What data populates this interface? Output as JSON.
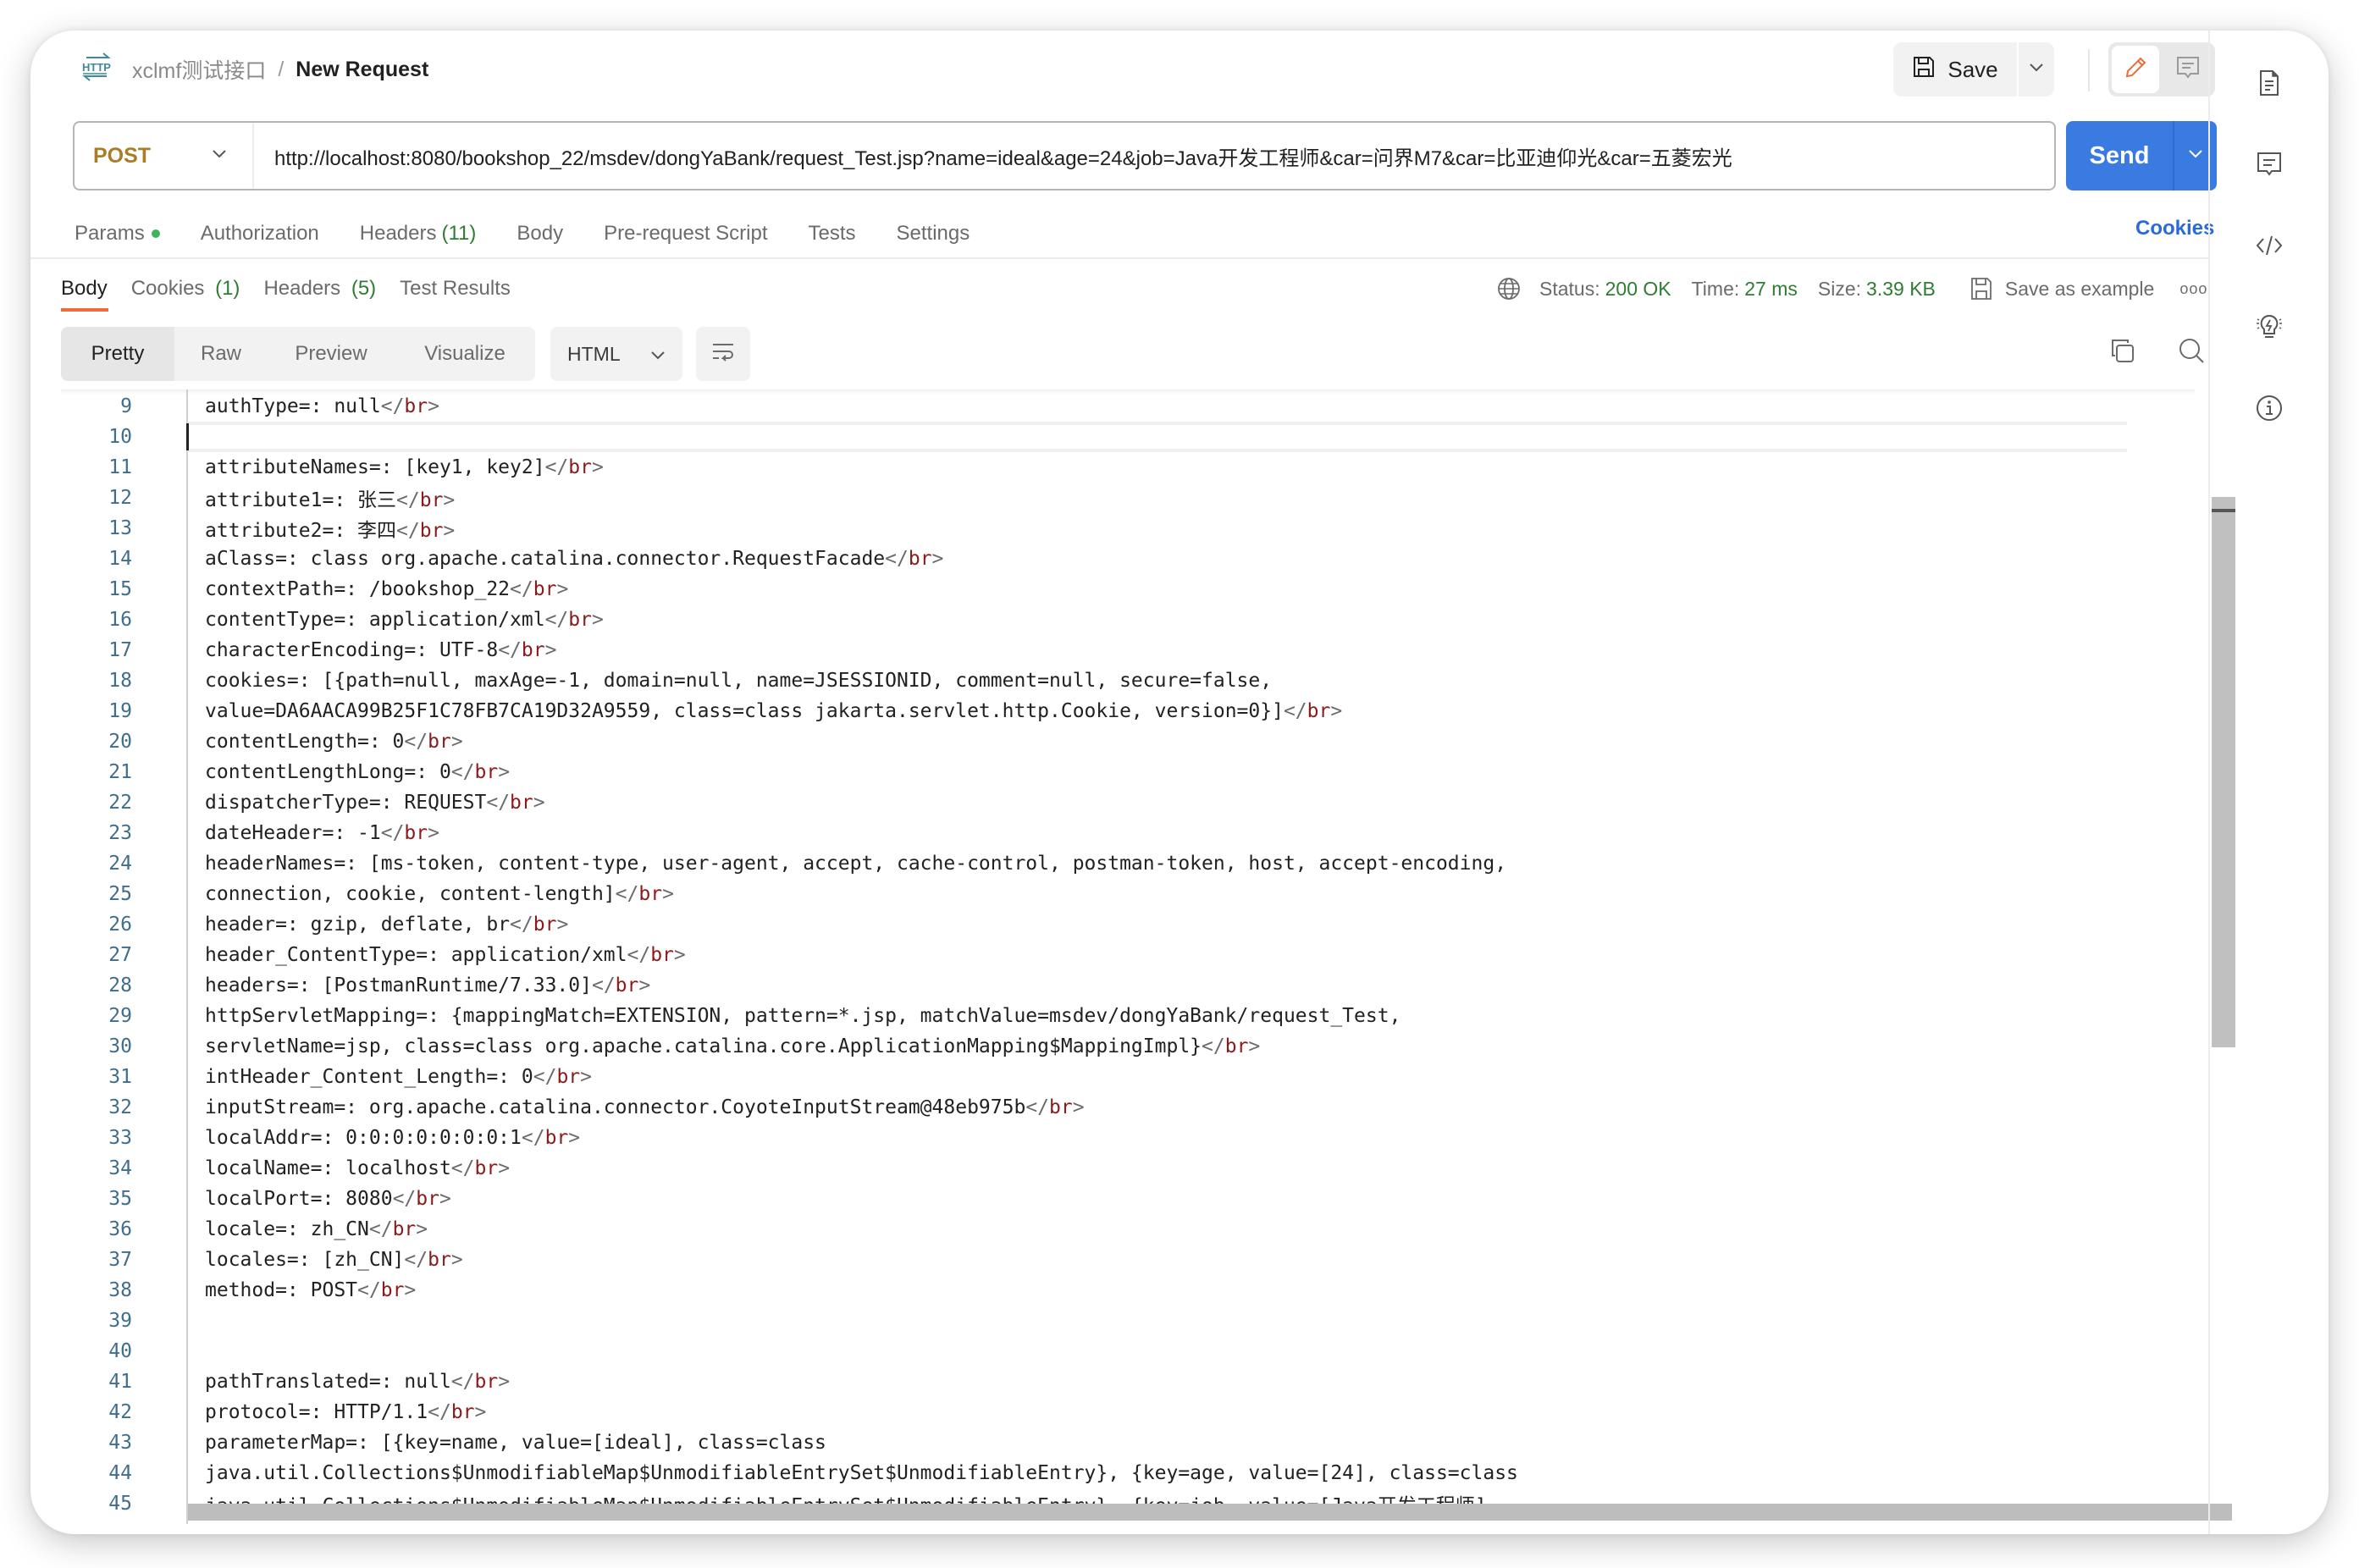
{
  "breadcrumb": {
    "icon": "http-icon",
    "parent": "xclmf测试接口",
    "separator": "/",
    "current": "New Request"
  },
  "toolbar": {
    "save_label": "Save",
    "mode_edit_icon": "pencil-icon",
    "mode_comment_icon": "comment-icon"
  },
  "request": {
    "method": "POST",
    "url": "http://localhost:8080/bookshop_22/msdev/dongYaBank/request_Test.jsp?name=ideal&age=24&job=Java开发工程师&car=问界M7&car=比亚迪仰光&car=五菱宏光",
    "send_label": "Send"
  },
  "request_tabs": [
    {
      "label": "Params",
      "indicator": "green-dot"
    },
    {
      "label": "Authorization"
    },
    {
      "label": "Headers",
      "count": "(11)"
    },
    {
      "label": "Body"
    },
    {
      "label": "Pre-request Script"
    },
    {
      "label": "Tests"
    },
    {
      "label": "Settings"
    }
  ],
  "cookies_link": "Cookies",
  "response_tabs": [
    {
      "label": "Body",
      "active": true
    },
    {
      "label": "Cookies",
      "count": "(1)"
    },
    {
      "label": "Headers",
      "count": "(5)"
    },
    {
      "label": "Test Results"
    }
  ],
  "response_meta": {
    "status_label": "Status:",
    "status_value": "200 OK",
    "time_label": "Time:",
    "time_value": "27 ms",
    "size_label": "Size:",
    "size_value": "3.39 KB",
    "save_example": "Save as example",
    "more": "ooo"
  },
  "view_modes": [
    "Pretty",
    "Raw",
    "Preview",
    "Visualize"
  ],
  "active_view": "Pretty",
  "language": "HTML",
  "colors": {
    "accent_blue": "#3a7be2",
    "method_post": "#a87d26",
    "status_green": "#2e7d32",
    "active_tab_underline": "#ef6c3a",
    "tag_color": "#8b1a1a",
    "line_number": "#3f6e8c"
  },
  "code_lines": [
    {
      "n": "9",
      "text": "authType=: null",
      "br": true
    },
    {
      "n": "10",
      "text": "",
      "br": false
    },
    {
      "n": "11",
      "text": "attributeNames=: [key1, key2]",
      "br": true
    },
    {
      "n": "12",
      "text": "attribute1=: 张三",
      "br": true
    },
    {
      "n": "13",
      "text": "attribute2=: 李四",
      "br": true
    },
    {
      "n": "14",
      "text": "aClass=: class org.apache.catalina.connector.RequestFacade",
      "br": true
    },
    {
      "n": "15",
      "text": "contextPath=: /bookshop_22",
      "br": true
    },
    {
      "n": "16",
      "text": "contentType=: application/xml",
      "br": true
    },
    {
      "n": "17",
      "text": "characterEncoding=: UTF-8",
      "br": true
    },
    {
      "n": "18",
      "text": "cookies=: [{path=null, maxAge=-1, domain=null, name=JSESSIONID, comment=null, secure=false,",
      "br": false
    },
    {
      "n": "19",
      "text": "value=DA6AACA99B25F1C78FB7CA19D32A9559, class=class jakarta.servlet.http.Cookie, version=0}]",
      "br": true
    },
    {
      "n": "20",
      "text": "contentLength=: 0",
      "br": true
    },
    {
      "n": "21",
      "text": "contentLengthLong=: 0",
      "br": true
    },
    {
      "n": "22",
      "text": "dispatcherType=: REQUEST",
      "br": true
    },
    {
      "n": "23",
      "text": "dateHeader=: -1",
      "br": true
    },
    {
      "n": "24",
      "text": "headerNames=: [ms-token, content-type, user-agent, accept, cache-control, postman-token, host, accept-encoding,",
      "br": false
    },
    {
      "n": "25",
      "text": "connection, cookie, content-length]",
      "br": true
    },
    {
      "n": "26",
      "text": "header=: gzip, deflate, br",
      "br": true
    },
    {
      "n": "27",
      "text": "header_ContentType=: application/xml",
      "br": true
    },
    {
      "n": "28",
      "text": "headers=: [PostmanRuntime/7.33.0]",
      "br": true
    },
    {
      "n": "29",
      "text": "httpServletMapping=: {mappingMatch=EXTENSION, pattern=*.jsp, matchValue=msdev/dongYaBank/request_Test,",
      "br": false
    },
    {
      "n": "30",
      "text": "servletName=jsp, class=class org.apache.catalina.core.ApplicationMapping$MappingImpl}",
      "br": true
    },
    {
      "n": "31",
      "text": "intHeader_Content_Length=: 0",
      "br": true
    },
    {
      "n": "32",
      "text": "inputStream=: org.apache.catalina.connector.CoyoteInputStream@48eb975b",
      "br": true
    },
    {
      "n": "33",
      "text": "localAddr=: 0:0:0:0:0:0:0:1",
      "br": true
    },
    {
      "n": "34",
      "text": "localName=: localhost",
      "br": true
    },
    {
      "n": "35",
      "text": "localPort=: 8080",
      "br": true
    },
    {
      "n": "36",
      "text": "locale=: zh_CN",
      "br": true
    },
    {
      "n": "37",
      "text": "locales=: [zh_CN]",
      "br": true
    },
    {
      "n": "38",
      "text": "method=: POST",
      "br": true
    },
    {
      "n": "39",
      "text": "",
      "br": false
    },
    {
      "n": "40",
      "text": "",
      "br": false
    },
    {
      "n": "41",
      "text": "pathTranslated=: null",
      "br": true
    },
    {
      "n": "42",
      "text": "protocol=: HTTP/1.1",
      "br": true
    },
    {
      "n": "43",
      "text": "parameterMap=: [{key=name, value=[ideal], class=class",
      "br": false
    },
    {
      "n": "44",
      "text": "java.util.Collections$UnmodifiableMap$UnmodifiableEntrySet$UnmodifiableEntry}, {key=age, value=[24], class=class",
      "br": false
    },
    {
      "n": "45",
      "text": "java.util.Collections$UnmodifiableMap$UnmodifiableEntrySet$UnmodifiableEntry}, {key=job, value=[Java开发工程师],",
      "br": false
    }
  ],
  "right_rail": [
    "document-icon",
    "comments-icon",
    "code-icon",
    "lightbulb-icon",
    "info-icon"
  ]
}
